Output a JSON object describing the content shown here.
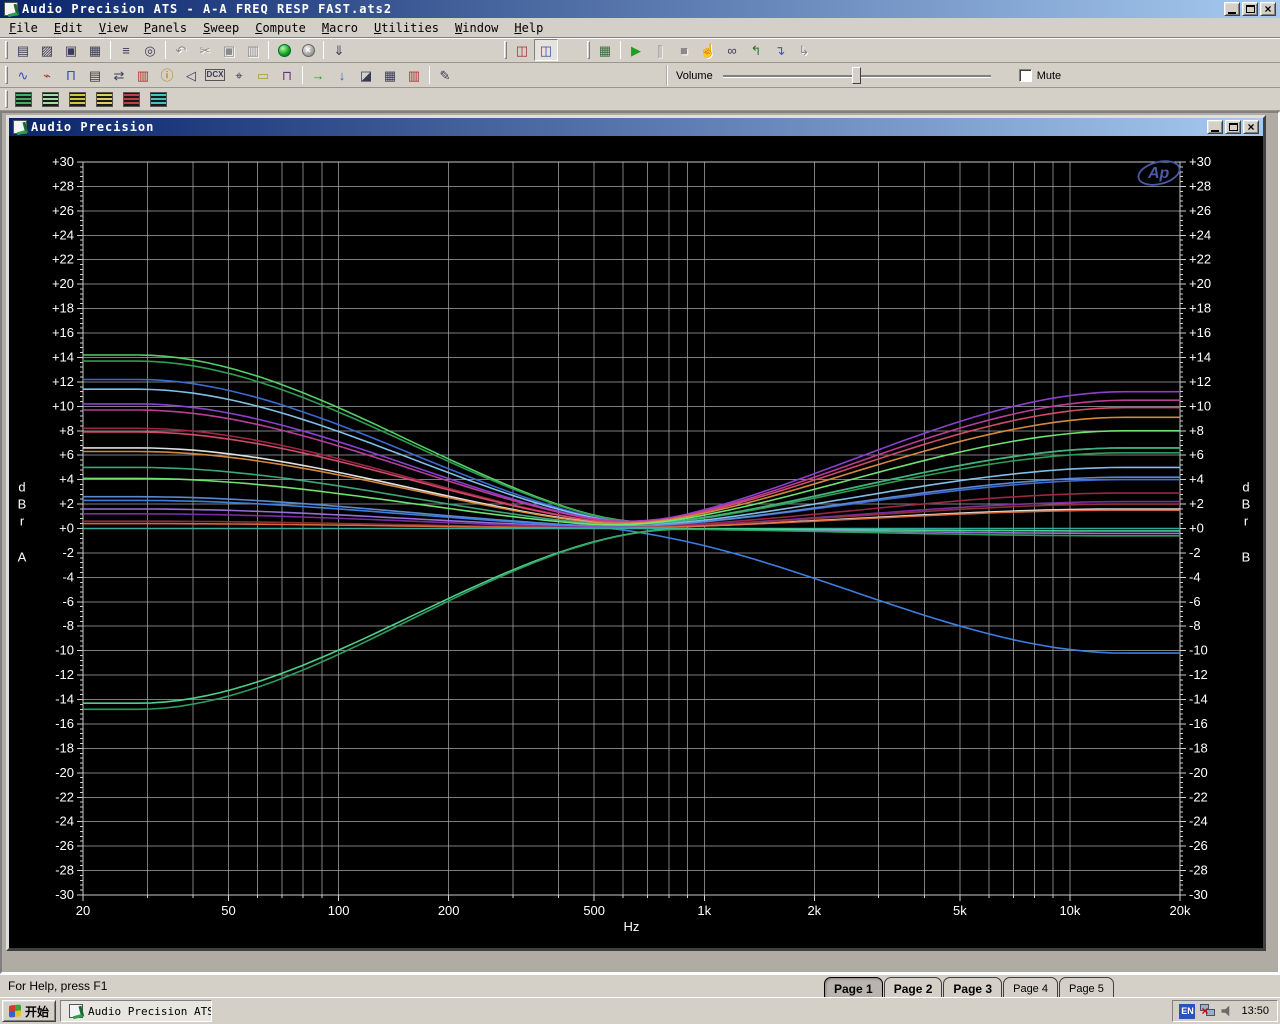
{
  "window": {
    "title": "Audio Precision ATS - A-A FREQ RESP FAST.ats2"
  },
  "icons": {
    "minimize": "_",
    "maximize": "maximize-box",
    "close": "×"
  },
  "menubar": {
    "items": [
      "File",
      "Edit",
      "View",
      "Panels",
      "Sweep",
      "Compute",
      "Macro",
      "Utilities",
      "Window",
      "Help"
    ]
  },
  "toolbars": {
    "main": [
      {
        "name": "new",
        "glyph": "▤"
      },
      {
        "name": "open",
        "glyph": "▨"
      },
      {
        "name": "save",
        "glyph": "▣"
      },
      {
        "name": "save-all",
        "glyph": "▦"
      },
      {
        "name": "sep"
      },
      {
        "name": "print",
        "glyph": "≡"
      },
      {
        "name": "print-preview",
        "glyph": "◎"
      },
      {
        "name": "sep"
      },
      {
        "name": "undo",
        "glyph": "↶",
        "disabled": true
      },
      {
        "name": "cut",
        "glyph": "✂",
        "disabled": true
      },
      {
        "name": "copy",
        "glyph": "▣",
        "disabled": true
      },
      {
        "name": "paste",
        "glyph": "▥",
        "disabled": true
      },
      {
        "name": "sep"
      },
      {
        "name": "start",
        "special": "circle-start"
      },
      {
        "name": "stop",
        "special": "circle-stop"
      },
      {
        "name": "sep"
      },
      {
        "name": "export",
        "glyph": "⇓"
      }
    ],
    "monitor": [
      {
        "name": "monitor-a",
        "glyph": "◫",
        "color": "#a03030"
      },
      {
        "name": "monitor-b",
        "glyph": "◫",
        "color": "#3050a0",
        "pressed": true
      }
    ],
    "transport": [
      {
        "name": "panel-setup",
        "glyph": "▦",
        "color": "#3a6a3a"
      },
      {
        "name": "sep"
      },
      {
        "name": "sweep-go",
        "glyph": "▶",
        "color": "#1f9f1f"
      },
      {
        "name": "sweep-pause",
        "glyph": "∥",
        "disabled": true
      },
      {
        "name": "sweep-stop",
        "glyph": "■",
        "disabled": true
      },
      {
        "name": "pan-hand",
        "glyph": "☝",
        "disabled": true
      },
      {
        "name": "monitors-glasses",
        "glyph": "∞"
      },
      {
        "name": "regulate-1",
        "glyph": "↰",
        "color": "#2f6f2f"
      },
      {
        "name": "regulate-2",
        "glyph": "↴",
        "color": "#2f5fbf"
      },
      {
        "name": "regulate-3",
        "glyph": "↳",
        "disabled": true
      }
    ],
    "panels": [
      {
        "name": "analog-generator",
        "glyph": "∿",
        "color": "#2f4fbf"
      },
      {
        "name": "wave-tool",
        "glyph": "⌁",
        "color": "#b03030"
      },
      {
        "name": "digital-generator",
        "glyph": "Π",
        "color": "#2f4fbf"
      },
      {
        "name": "analyzer",
        "glyph": "▤",
        "color": "#3a3a3a"
      },
      {
        "name": "digital-io",
        "glyph": "⇄",
        "color": "#3a3a56"
      },
      {
        "name": "settling",
        "glyph": "▥",
        "color": "#b03030"
      },
      {
        "name": "status-info",
        "glyph": "ⓘ",
        "color": "#b06a00"
      },
      {
        "name": "speaker-monitor",
        "glyph": "◁",
        "color": "#3a3a56"
      },
      {
        "name": "dcx-panel",
        "glyph": "DCX",
        "small": true
      },
      {
        "name": "switcher",
        "glyph": "⌖",
        "color": "#3a3a56"
      },
      {
        "name": "sweep-panel",
        "glyph": "▭",
        "color": "#b09a2a"
      },
      {
        "name": "digital-analyzer",
        "glyph": "⊓",
        "color": "#6a2a8a"
      },
      {
        "name": "sep"
      },
      {
        "name": "go-arrow",
        "glyph": "→",
        "color": "#1f9f1f"
      },
      {
        "name": "append-arrow",
        "glyph": "↓",
        "color": "#2f5fbf"
      },
      {
        "name": "graph-display",
        "glyph": "◪",
        "color": "#3a3a56"
      },
      {
        "name": "data-editor",
        "glyph": "▦",
        "color": "#3a3a56"
      },
      {
        "name": "bar-graph",
        "glyph": "▥",
        "color": "#b03030"
      },
      {
        "name": "sep"
      },
      {
        "name": "report-editor",
        "glyph": "✎",
        "color": "#3a3a56"
      }
    ],
    "workspaces": [
      {
        "name": "workspace-1",
        "c1": "#1a1a1a",
        "c2": "#3fae5f"
      },
      {
        "name": "workspace-2",
        "c1": "#1a1a1a",
        "c2": "#9fdf9f"
      },
      {
        "name": "workspace-3",
        "c1": "#1a1a1a",
        "c2": "#d4c43f"
      },
      {
        "name": "workspace-4",
        "c1": "#1a1a1a",
        "c2": "#e0d060"
      },
      {
        "name": "workspace-5",
        "c1": "#1a1a1a",
        "c2": "#c04040"
      },
      {
        "name": "workspace-6",
        "c1": "#1a1a1a",
        "c2": "#3fc4c4"
      }
    ]
  },
  "volume": {
    "label": "Volume",
    "mute_label": "Mute",
    "value_pct": 50,
    "muted": false
  },
  "inner_window": {
    "title": "Audio Precision"
  },
  "status": {
    "help_text": "For Help, press F1"
  },
  "page_tabs": [
    {
      "label": "Page 1",
      "active": true,
      "bold": true
    },
    {
      "label": "Page 2",
      "active": false,
      "bold": true
    },
    {
      "label": "Page 3",
      "active": false,
      "bold": true
    },
    {
      "label": "Page 4",
      "active": false,
      "bold": false
    },
    {
      "label": "Page 5",
      "active": false,
      "bold": false
    }
  ],
  "taskbar": {
    "start_label": "开始",
    "task_label": "Audio Precision ATS...",
    "tray": {
      "lang": "EN",
      "time": "13:50"
    }
  },
  "chart_data": {
    "type": "line",
    "title": "",
    "xlabel": "Hz",
    "x_axis": {
      "scale": "log",
      "min": 20,
      "max": 20000,
      "unit": "Hz",
      "ticks": [
        {
          "f": 20,
          "label": "20"
        },
        {
          "f": 50,
          "label": "50"
        },
        {
          "f": 100,
          "label": "100"
        },
        {
          "f": 200,
          "label": "200"
        },
        {
          "f": 500,
          "label": "500"
        },
        {
          "f": 1000,
          "label": "1k"
        },
        {
          "f": 2000,
          "label": "2k"
        },
        {
          "f": 5000,
          "label": "5k"
        },
        {
          "f": 10000,
          "label": "10k"
        },
        {
          "f": 20000,
          "label": "20k"
        }
      ],
      "grid_freqs": [
        20,
        30,
        40,
        50,
        60,
        70,
        80,
        90,
        100,
        200,
        300,
        400,
        500,
        600,
        700,
        800,
        900,
        1000,
        2000,
        3000,
        4000,
        5000,
        6000,
        7000,
        8000,
        9000,
        10000,
        20000
      ]
    },
    "y_axis": {
      "min": -30,
      "max": 30,
      "step": 2,
      "left_label": "dBr A",
      "right_label": "dBr B",
      "tick_labels": [
        "+30",
        "+28",
        "+26",
        "+24",
        "+22",
        "+20",
        "+18",
        "+16",
        "+14",
        "+12",
        "+10",
        "+8",
        "+6",
        "+4",
        "+2",
        "+0",
        "-2",
        "-4",
        "-6",
        "-8",
        "-10",
        "-12",
        "-14",
        "-16",
        "-18",
        "-20",
        "-22",
        "-24",
        "-26",
        "-28",
        "-30"
      ]
    },
    "logo": "Ap",
    "colors": {
      "background": "#000000",
      "grid": "#a8a8a8",
      "frame": "#c8c8c8",
      "logo": "#4a5aa8"
    },
    "series": [
      {
        "name": "trace-01",
        "color": "#58d96a",
        "db_20hz": 14.2,
        "db_20khz": 6.6
      },
      {
        "name": "trace-02",
        "color": "#2fa355",
        "db_20hz": 13.7,
        "db_20khz": 6.2
      },
      {
        "name": "trace-03",
        "color": "#3f6fd9",
        "db_20hz": 12.2,
        "db_20khz": 4.0
      },
      {
        "name": "trace-04",
        "color": "#86c9f2",
        "db_20hz": 11.4,
        "db_20khz": 5.0
      },
      {
        "name": "trace-05",
        "color": "#8e44d9",
        "db_20hz": 10.2,
        "db_20khz": 11.2
      },
      {
        "name": "trace-06",
        "color": "#c43f9e",
        "db_20hz": 9.7,
        "db_20khz": 10.5
      },
      {
        "name": "trace-07",
        "color": "#a3274a",
        "db_20hz": 8.2,
        "db_20khz": 2.9
      },
      {
        "name": "trace-08",
        "color": "#d94f6f",
        "db_20hz": 7.9,
        "db_20khz": 9.9
      },
      {
        "name": "trace-09",
        "color": "#ececec",
        "db_20hz": 6.6,
        "db_20khz": 1.6
      },
      {
        "name": "trace-10",
        "color": "#df8f3f",
        "db_20hz": 6.3,
        "db_20khz": 9.1
      },
      {
        "name": "trace-11",
        "color": "#3fae7f",
        "db_20hz": 5.0,
        "db_20khz": 6.6
      },
      {
        "name": "trace-12",
        "color": "#74ec74",
        "db_20hz": 4.1,
        "db_20khz": 8.0
      },
      {
        "name": "trace-13",
        "color": "#5f8fd9",
        "db_20hz": 2.6,
        "db_20khz": 4.2
      },
      {
        "name": "trace-14",
        "color": "#3f86ec",
        "db_20hz": 2.3,
        "db_20khz": -10.2
      },
      {
        "name": "trace-15",
        "color": "#9f74e4",
        "db_20hz": 1.6,
        "db_20khz": -0.4
      },
      {
        "name": "trace-16",
        "color": "#7f2fa8",
        "db_20hz": 1.2,
        "db_20khz": 2.2
      },
      {
        "name": "trace-17",
        "color": "#8f3434",
        "db_20hz": 0.6,
        "db_20khz": 2.0
      },
      {
        "name": "trace-18",
        "color": "#df6a3f",
        "db_20hz": 0.4,
        "db_20khz": 1.5
      },
      {
        "name": "trace-19",
        "color": "#2fae9e",
        "db_20hz": 0.0,
        "db_20khz": 0.0
      },
      {
        "name": "trace-20",
        "color": "#52d98f",
        "db_20hz": -14.3,
        "db_20khz": -0.2
      },
      {
        "name": "trace-21",
        "color": "#2fa363",
        "db_20hz": -14.8,
        "db_20khz": -0.6
      }
    ]
  }
}
